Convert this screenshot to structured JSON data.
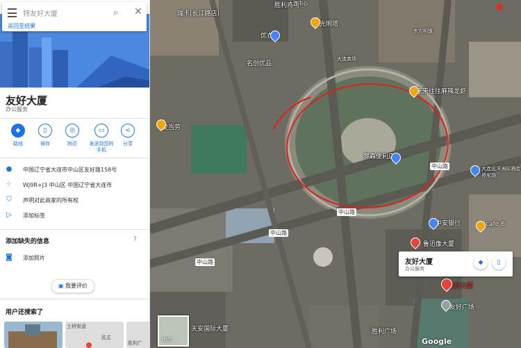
{
  "search": {
    "placeholder": "特友好大厦",
    "back_link": "返回至结果"
  },
  "place": {
    "name": "友好大厦",
    "category": "办公服务"
  },
  "actions": [
    {
      "label": "路线",
      "icon": "directions-icon"
    },
    {
      "label": "保存",
      "icon": "bookmark-icon"
    },
    {
      "label": "附近",
      "icon": "nearby-icon"
    },
    {
      "label": "发送到您的\n手机",
      "icon": "send-to-phone-icon"
    },
    {
      "label": "分享",
      "icon": "share-icon"
    }
  ],
  "info": [
    {
      "icon": "location-icon",
      "text": "中国辽宁省大连市中山区友好路158号"
    },
    {
      "icon": "plus-code-icon",
      "text": "WJ9R+J3 中山区 中国辽宁省大连市"
    },
    {
      "icon": "shield-icon",
      "text": "声明对此商家的所有权"
    },
    {
      "icon": "label-icon",
      "text": "添加标签"
    }
  ],
  "missing": {
    "heading": "添加缺失的信息",
    "add_photo": "添加照片"
  },
  "review_button": "我要评价",
  "also_searched": {
    "heading": "用户还搜索了",
    "thumbs": [
      "胜利广",
      "民主",
      "土桥街道"
    ]
  },
  "card": {
    "name": "友好大厦",
    "category": "办公服务"
  },
  "minimap_label": "地图",
  "google_mark": "Google",
  "map_labels": [
    {
      "text": "瑞卡(长江路店)"
    },
    {
      "text": "胜利商场"
    },
    {
      "text": "优衣库"
    },
    {
      "text": "名创优品"
    },
    {
      "text": "光明塔"
    },
    {
      "text": "大连商场"
    },
    {
      "text": "东方明珠"
    },
    {
      "text": "麦当劳"
    },
    {
      "text": "来来往往麻辣龙虾"
    },
    {
      "text": "罗森便利店"
    },
    {
      "text": "中山路"
    },
    {
      "text": "中山路"
    },
    {
      "text": "中山路"
    },
    {
      "text": "中山路"
    },
    {
      "text": "大连远洋洲际酒店停车场"
    },
    {
      "text": "中安银行"
    },
    {
      "text": "cafe 6"
    },
    {
      "text": "鲁迅像大厦"
    },
    {
      "text": "友好广场"
    },
    {
      "text": "友好大厦"
    },
    {
      "text": "天安国际大厦"
    },
    {
      "text": "胜利广场"
    },
    {
      "text": "大连中心"
    }
  ]
}
